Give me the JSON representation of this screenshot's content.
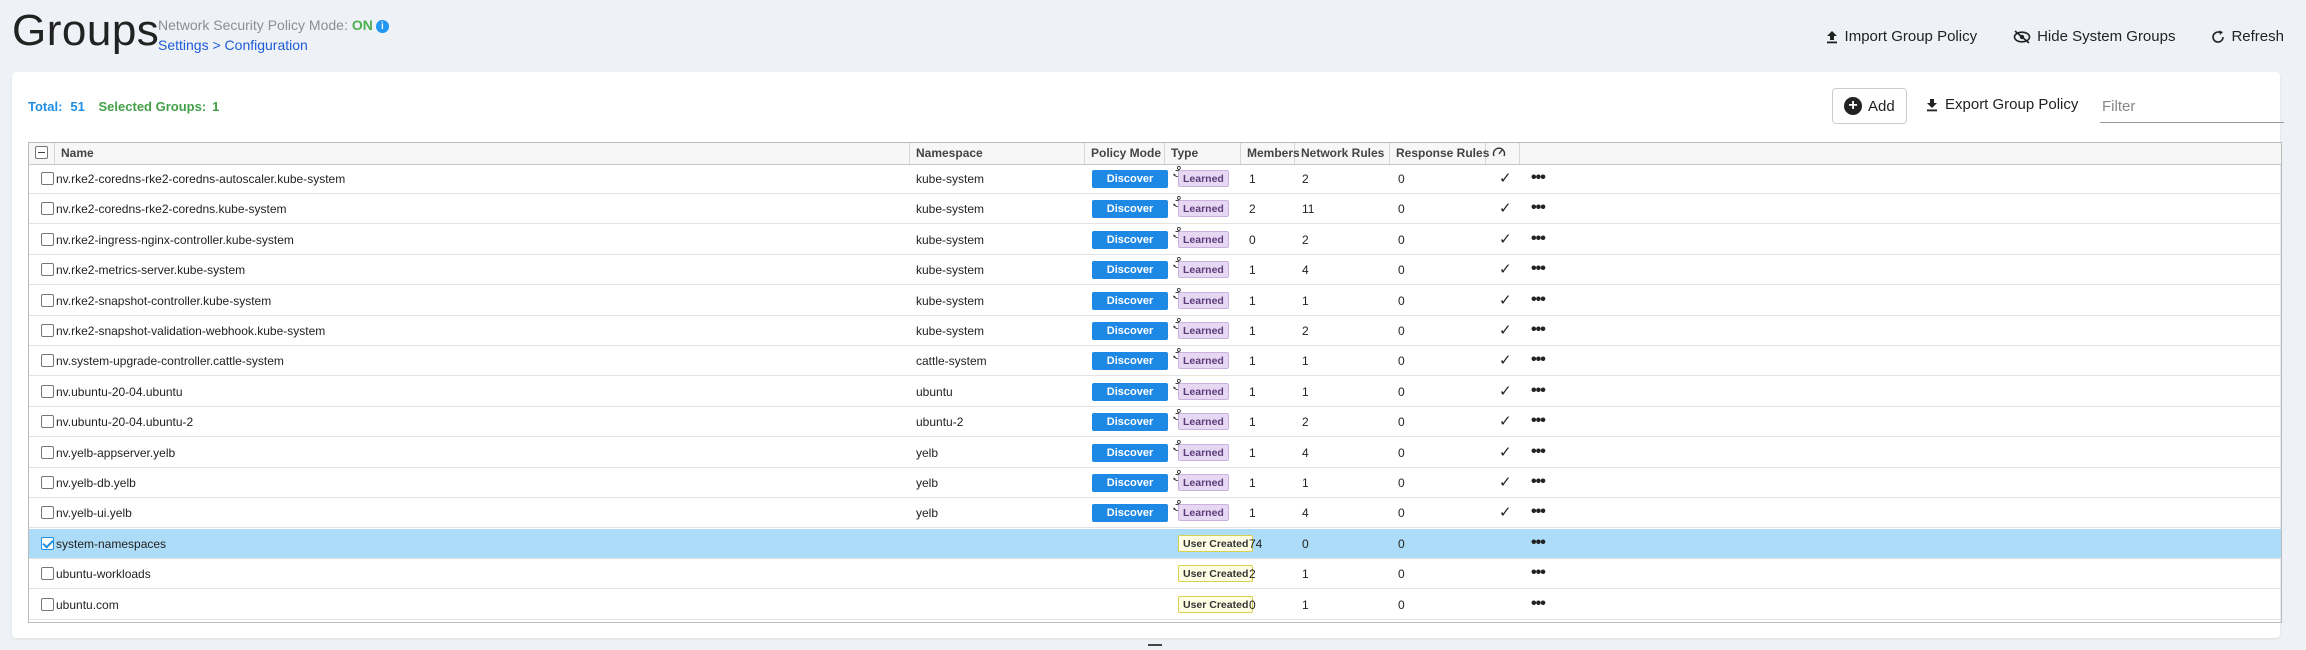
{
  "page": {
    "title": "Groups",
    "policy_mode_label": "Network Security Policy Mode:",
    "policy_mode_value": "ON",
    "breadcrumb": "Settings > Configuration"
  },
  "toolbar": {
    "import_label": "Import Group Policy",
    "hide_label": "Hide System Groups",
    "refresh_label": "Refresh"
  },
  "summary": {
    "total_label": "Total:",
    "total_value": "51",
    "selected_label": "Selected Groups:",
    "selected_value": "1"
  },
  "actions": {
    "add_label": "Add",
    "export_label": "Export Group Policy",
    "filter_placeholder": "Filter"
  },
  "colors": {
    "accent_blue": "#1e88e5",
    "on_green": "#4caf50",
    "selected_row": "#addcf8",
    "learned_badge": "#e6d7f2",
    "user_badge": "#fffde4"
  },
  "table": {
    "columns": {
      "name": "Name",
      "namespace": "Namespace",
      "policy_mode": "Policy Mode",
      "type": "Type",
      "members": "Members",
      "network_rules": "Network Rules",
      "response_rules": "Response Rules",
      "status_icon": "gauge-icon"
    },
    "rows": [
      {
        "name": "nv.rke2-coredns-rke2-coredns-autoscaler.kube-system",
        "namespace": "kube-system",
        "mode": "Discover",
        "type": "Learned",
        "members": "1",
        "network": "2",
        "response": "0",
        "check": "✓",
        "selected": false
      },
      {
        "name": "nv.rke2-coredns-rke2-coredns.kube-system",
        "namespace": "kube-system",
        "mode": "Discover",
        "type": "Learned",
        "members": "2",
        "network": "11",
        "response": "0",
        "check": "✓",
        "selected": false
      },
      {
        "name": "nv.rke2-ingress-nginx-controller.kube-system",
        "namespace": "kube-system",
        "mode": "Discover",
        "type": "Learned",
        "members": "0",
        "network": "2",
        "response": "0",
        "check": "✓",
        "selected": false
      },
      {
        "name": "nv.rke2-metrics-server.kube-system",
        "namespace": "kube-system",
        "mode": "Discover",
        "type": "Learned",
        "members": "1",
        "network": "4",
        "response": "0",
        "check": "✓",
        "selected": false
      },
      {
        "name": "nv.rke2-snapshot-controller.kube-system",
        "namespace": "kube-system",
        "mode": "Discover",
        "type": "Learned",
        "members": "1",
        "network": "1",
        "response": "0",
        "check": "✓",
        "selected": false
      },
      {
        "name": "nv.rke2-snapshot-validation-webhook.kube-system",
        "namespace": "kube-system",
        "mode": "Discover",
        "type": "Learned",
        "members": "1",
        "network": "2",
        "response": "0",
        "check": "✓",
        "selected": false
      },
      {
        "name": "nv.system-upgrade-controller.cattle-system",
        "namespace": "cattle-system",
        "mode": "Discover",
        "type": "Learned",
        "members": "1",
        "network": "1",
        "response": "0",
        "check": "✓",
        "selected": false
      },
      {
        "name": "nv.ubuntu-20-04.ubuntu",
        "namespace": "ubuntu",
        "mode": "Discover",
        "type": "Learned",
        "members": "1",
        "network": "1",
        "response": "0",
        "check": "✓",
        "selected": false
      },
      {
        "name": "nv.ubuntu-20-04.ubuntu-2",
        "namespace": "ubuntu-2",
        "mode": "Discover",
        "type": "Learned",
        "members": "1",
        "network": "2",
        "response": "0",
        "check": "✓",
        "selected": false
      },
      {
        "name": "nv.yelb-appserver.yelb",
        "namespace": "yelb",
        "mode": "Discover",
        "type": "Learned",
        "members": "1",
        "network": "4",
        "response": "0",
        "check": "✓",
        "selected": false
      },
      {
        "name": "nv.yelb-db.yelb",
        "namespace": "yelb",
        "mode": "Discover",
        "type": "Learned",
        "members": "1",
        "network": "1",
        "response": "0",
        "check": "✓",
        "selected": false
      },
      {
        "name": "nv.yelb-ui.yelb",
        "namespace": "yelb",
        "mode": "Discover",
        "type": "Learned",
        "members": "1",
        "network": "4",
        "response": "0",
        "check": "✓",
        "selected": false
      },
      {
        "name": "system-namespaces",
        "namespace": "",
        "mode": "",
        "type": "User Created",
        "members": "74",
        "network": "0",
        "response": "0",
        "check": "",
        "selected": true
      },
      {
        "name": "ubuntu-workloads",
        "namespace": "",
        "mode": "",
        "type": "User Created",
        "members": "2",
        "network": "1",
        "response": "0",
        "check": "",
        "selected": false
      },
      {
        "name": "ubuntu.com",
        "namespace": "",
        "mode": "",
        "type": "User Created",
        "members": "0",
        "network": "1",
        "response": "0",
        "check": "",
        "selected": false
      }
    ]
  }
}
